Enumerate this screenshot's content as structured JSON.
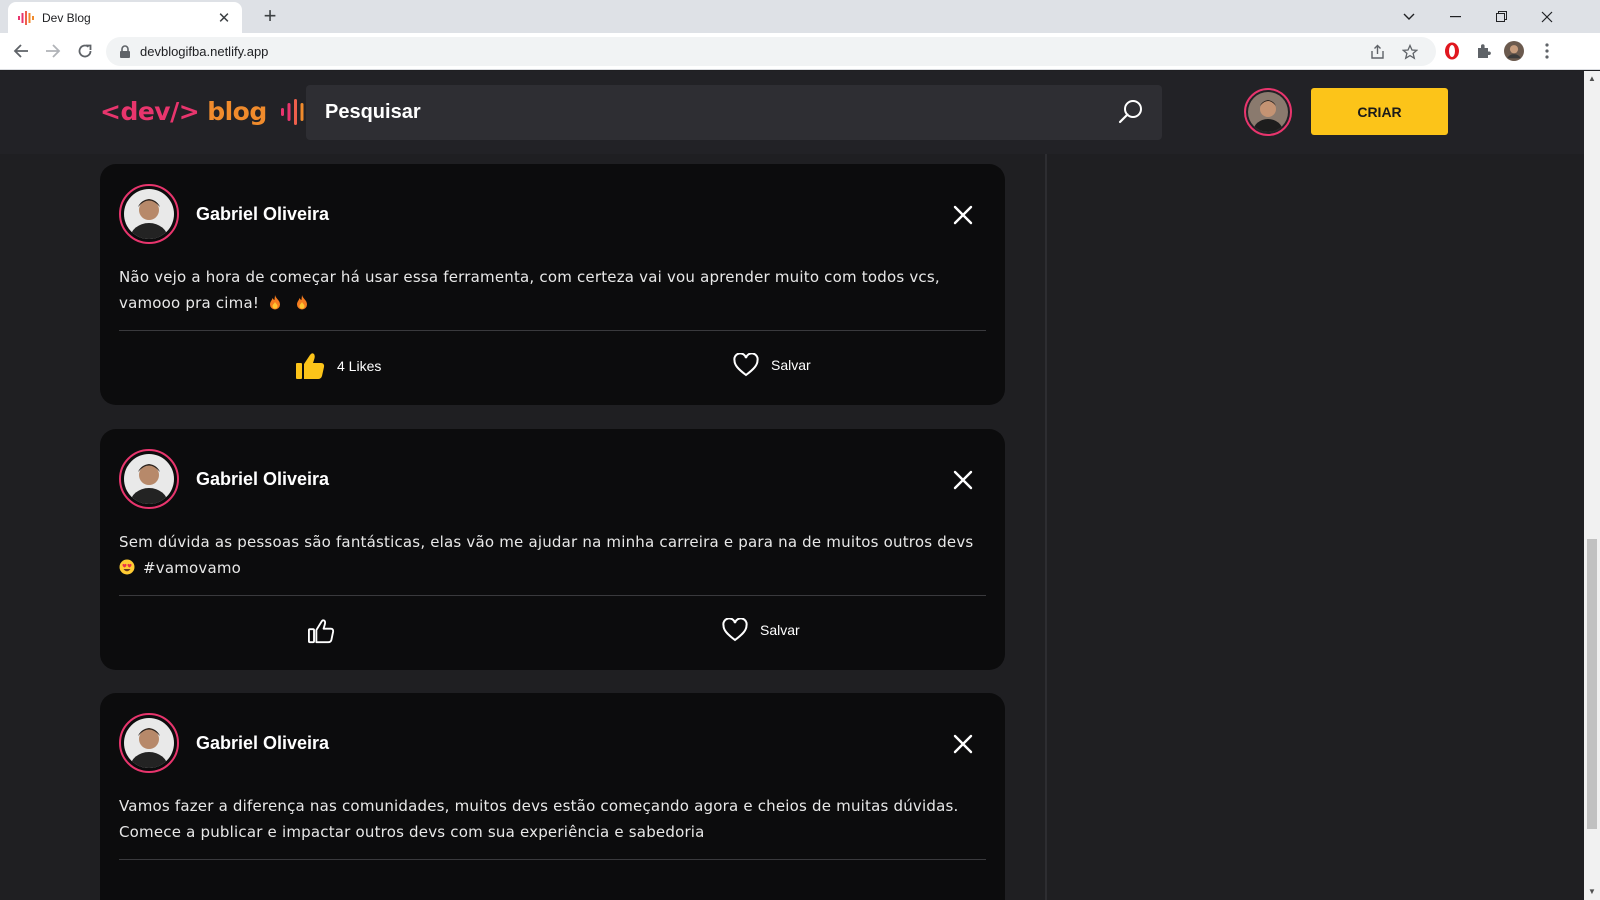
{
  "browser": {
    "tab_title": "Dev Blog",
    "url": "devblogifba.netlify.app"
  },
  "header": {
    "logo_tag": "<dev/>",
    "logo_word": "blog",
    "search_placeholder": "Pesquisar",
    "create_button": "CRIAR"
  },
  "posts": [
    {
      "author": "Gabriel Oliveira",
      "text": "Não vejo a hora de começar há usar essa ferramenta, com certeza vai vou aprender muito com todos vcs, vamooo pra cima!",
      "like_label": "4 Likes",
      "liked": true,
      "save_label": "Salvar"
    },
    {
      "author": "Gabriel Oliveira",
      "text": "Sem dúvida as pessoas são fantásticas, elas vão me ajudar na minha carreira e para na de muitos outros devs",
      "hashtag": "#vamovamo",
      "like_label": "",
      "liked": false,
      "save_label": "Salvar"
    },
    {
      "author": "Gabriel Oliveira",
      "text_line1": "Vamos fazer a diferença nas comunidades, muitos devs estão começando agora e cheios de muitas dúvidas.",
      "text_line2": "Comece a publicar e impactar outros devs com sua experiência e sabedoria"
    }
  ],
  "colors": {
    "accent_pink": "#e8356d",
    "accent_orange": "#f08b2c",
    "create_yellow": "#fcc419",
    "like_yellow": "#fcc419"
  }
}
